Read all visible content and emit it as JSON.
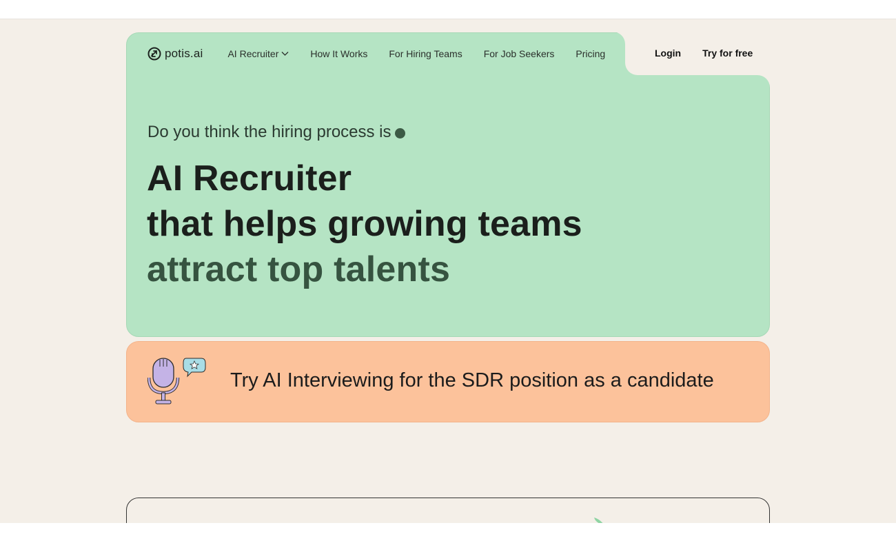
{
  "brand": {
    "name": "potis.ai",
    "icon": "potis-logo-icon"
  },
  "nav": {
    "items": [
      {
        "label": "AI Recruiter",
        "has_dropdown": true
      },
      {
        "label": "How It Works"
      },
      {
        "label": "For Hiring Teams"
      },
      {
        "label": "For Job Seekers"
      },
      {
        "label": "Pricing"
      }
    ],
    "login": "Login",
    "try_free": "Try for free"
  },
  "hero": {
    "subheading": "Do you think the hiring process is",
    "title_line1": "AI Recruiter",
    "title_line2": "that helps growing teams",
    "title_line3": "attract top talents"
  },
  "promo": {
    "text": "Try AI Interviewing for the SDR position as a candidate",
    "icon": "microphone-speech-bubble-icon"
  },
  "colors": {
    "page_bg": "#f4efe8",
    "hero_bg": "#b5e4c4",
    "promo_bg": "#fcc29b",
    "accent_dark_green": "#365340"
  }
}
